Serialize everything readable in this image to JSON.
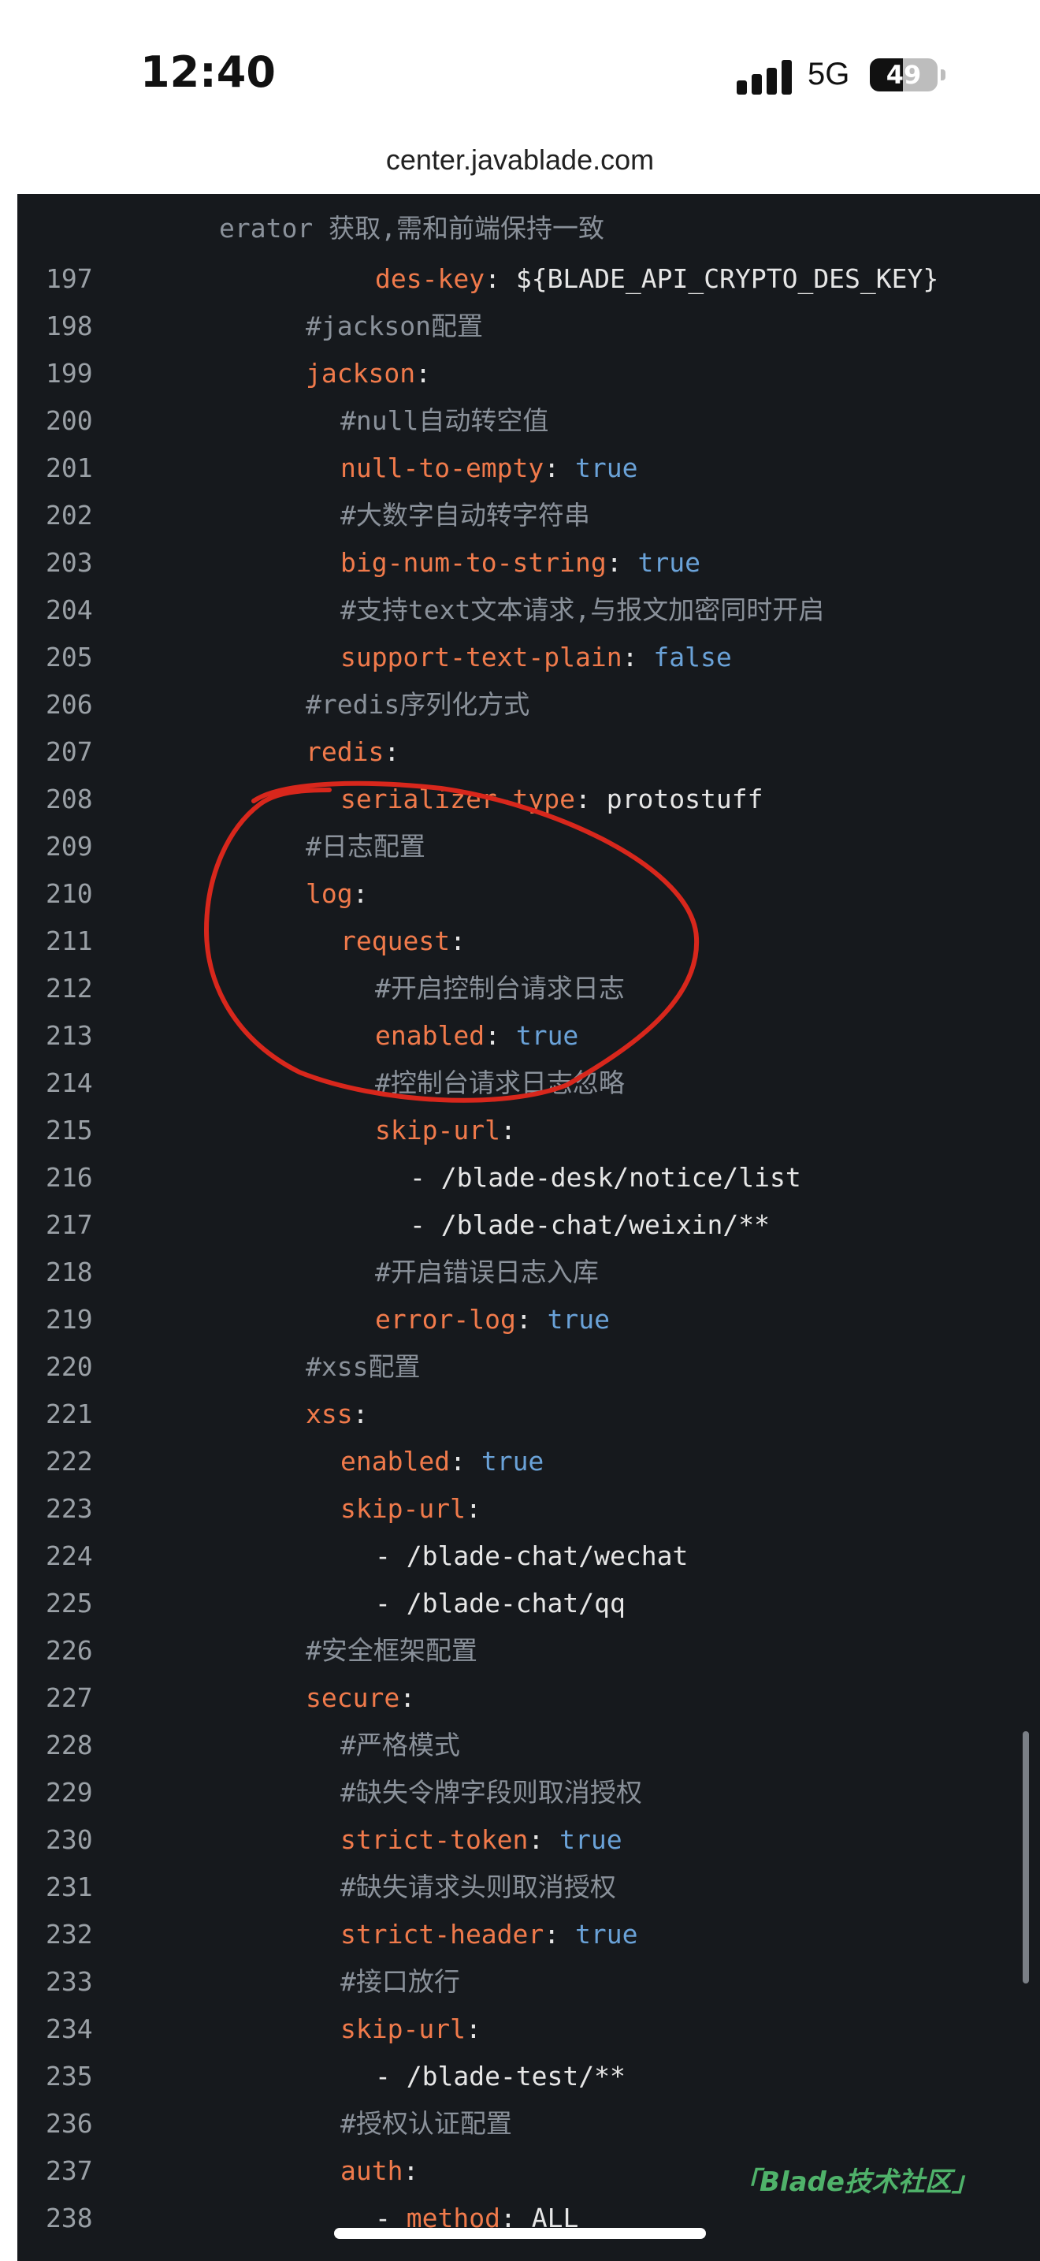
{
  "status_bar": {
    "time": "12:40",
    "network": "5G",
    "battery": "49",
    "battery_level": 0.49
  },
  "url_bar": {
    "url": "center.javablade.com"
  },
  "code": {
    "wrapped_continuation": "erator 获取,需和前端保持一致",
    "lines": [
      {
        "n": "197",
        "indent": 6,
        "parts": [
          {
            "t": "des-key",
            "c": "key"
          },
          {
            "t": ": ",
            "c": "punct"
          },
          {
            "t": "${BLADE_API_CRYPTO_DES_KEY}",
            "c": "plain"
          }
        ]
      },
      {
        "n": "198",
        "indent": 4,
        "parts": [
          {
            "t": "#jackson配置",
            "c": "comment"
          }
        ]
      },
      {
        "n": "199",
        "indent": 4,
        "parts": [
          {
            "t": "jackson",
            "c": "key"
          },
          {
            "t": ":",
            "c": "punct"
          }
        ]
      },
      {
        "n": "200",
        "indent": 5,
        "parts": [
          {
            "t": "#null自动转空值",
            "c": "comment"
          }
        ]
      },
      {
        "n": "201",
        "indent": 5,
        "parts": [
          {
            "t": "null-to-empty",
            "c": "key"
          },
          {
            "t": ": ",
            "c": "punct"
          },
          {
            "t": "true",
            "c": "bool"
          }
        ]
      },
      {
        "n": "202",
        "indent": 5,
        "parts": [
          {
            "t": "#大数字自动转字符串",
            "c": "comment"
          }
        ]
      },
      {
        "n": "203",
        "indent": 5,
        "parts": [
          {
            "t": "big-num-to-string",
            "c": "key"
          },
          {
            "t": ": ",
            "c": "punct"
          },
          {
            "t": "true",
            "c": "bool"
          }
        ]
      },
      {
        "n": "204",
        "indent": 5,
        "parts": [
          {
            "t": "#支持text文本请求,与报文加密同时开启",
            "c": "comment"
          }
        ]
      },
      {
        "n": "205",
        "indent": 5,
        "parts": [
          {
            "t": "support-text-plain",
            "c": "key"
          },
          {
            "t": ": ",
            "c": "punct"
          },
          {
            "t": "false",
            "c": "bool"
          }
        ]
      },
      {
        "n": "206",
        "indent": 4,
        "parts": [
          {
            "t": "#redis序列化方式",
            "c": "comment"
          }
        ]
      },
      {
        "n": "207",
        "indent": 4,
        "parts": [
          {
            "t": "redis",
            "c": "key"
          },
          {
            "t": ":",
            "c": "punct"
          }
        ]
      },
      {
        "n": "208",
        "indent": 5,
        "parts": [
          {
            "t": "serializer-type",
            "c": "key"
          },
          {
            "t": ": ",
            "c": "punct"
          },
          {
            "t": "protostuff",
            "c": "plain"
          }
        ]
      },
      {
        "n": "209",
        "indent": 4,
        "parts": [
          {
            "t": "#日志配置",
            "c": "comment"
          }
        ]
      },
      {
        "n": "210",
        "indent": 4,
        "parts": [
          {
            "t": "log",
            "c": "key"
          },
          {
            "t": ":",
            "c": "punct"
          }
        ]
      },
      {
        "n": "211",
        "indent": 5,
        "parts": [
          {
            "t": "request",
            "c": "key"
          },
          {
            "t": ":",
            "c": "punct"
          }
        ]
      },
      {
        "n": "212",
        "indent": 6,
        "parts": [
          {
            "t": "#开启控制台请求日志",
            "c": "comment"
          }
        ]
      },
      {
        "n": "213",
        "indent": 6,
        "parts": [
          {
            "t": "enabled",
            "c": "key"
          },
          {
            "t": ": ",
            "c": "punct"
          },
          {
            "t": "true",
            "c": "bool"
          }
        ]
      },
      {
        "n": "214",
        "indent": 6,
        "parts": [
          {
            "t": "#控制台请求日志忽略",
            "c": "comment"
          }
        ]
      },
      {
        "n": "215",
        "indent": 6,
        "parts": [
          {
            "t": "skip-url",
            "c": "key"
          },
          {
            "t": ":",
            "c": "punct"
          }
        ]
      },
      {
        "n": "216",
        "indent": 7,
        "parts": [
          {
            "t": "- /blade-desk/notice/list",
            "c": "plain"
          }
        ]
      },
      {
        "n": "217",
        "indent": 7,
        "parts": [
          {
            "t": "- /blade-chat/weixin/**",
            "c": "plain"
          }
        ]
      },
      {
        "n": "218",
        "indent": 6,
        "parts": [
          {
            "t": "#开启错误日志入库",
            "c": "comment"
          }
        ]
      },
      {
        "n": "219",
        "indent": 6,
        "parts": [
          {
            "t": "error-log",
            "c": "key"
          },
          {
            "t": ": ",
            "c": "punct"
          },
          {
            "t": "true",
            "c": "bool"
          }
        ]
      },
      {
        "n": "220",
        "indent": 4,
        "parts": [
          {
            "t": "#xss配置",
            "c": "comment"
          }
        ]
      },
      {
        "n": "221",
        "indent": 4,
        "parts": [
          {
            "t": "xss",
            "c": "key"
          },
          {
            "t": ":",
            "c": "punct"
          }
        ]
      },
      {
        "n": "222",
        "indent": 5,
        "parts": [
          {
            "t": "enabled",
            "c": "key"
          },
          {
            "t": ": ",
            "c": "punct"
          },
          {
            "t": "true",
            "c": "bool"
          }
        ]
      },
      {
        "n": "223",
        "indent": 5,
        "parts": [
          {
            "t": "skip-url",
            "c": "key"
          },
          {
            "t": ":",
            "c": "punct"
          }
        ]
      },
      {
        "n": "224",
        "indent": 6,
        "parts": [
          {
            "t": "- /blade-chat/wechat",
            "c": "plain"
          }
        ]
      },
      {
        "n": "225",
        "indent": 6,
        "parts": [
          {
            "t": "- /blade-chat/qq",
            "c": "plain"
          }
        ]
      },
      {
        "n": "226",
        "indent": 4,
        "parts": [
          {
            "t": "#安全框架配置",
            "c": "comment"
          }
        ]
      },
      {
        "n": "227",
        "indent": 4,
        "parts": [
          {
            "t": "secure",
            "c": "key"
          },
          {
            "t": ":",
            "c": "punct"
          }
        ]
      },
      {
        "n": "228",
        "indent": 5,
        "parts": [
          {
            "t": "#严格模式",
            "c": "comment"
          }
        ]
      },
      {
        "n": "229",
        "indent": 5,
        "parts": [
          {
            "t": "#缺失令牌字段则取消授权",
            "c": "comment"
          }
        ]
      },
      {
        "n": "230",
        "indent": 5,
        "parts": [
          {
            "t": "strict-token",
            "c": "key"
          },
          {
            "t": ": ",
            "c": "punct"
          },
          {
            "t": "true",
            "c": "bool"
          }
        ]
      },
      {
        "n": "231",
        "indent": 5,
        "parts": [
          {
            "t": "#缺失请求头则取消授权",
            "c": "comment"
          }
        ]
      },
      {
        "n": "232",
        "indent": 5,
        "parts": [
          {
            "t": "strict-header",
            "c": "key"
          },
          {
            "t": ": ",
            "c": "punct"
          },
          {
            "t": "true",
            "c": "bool"
          }
        ]
      },
      {
        "n": "233",
        "indent": 5,
        "parts": [
          {
            "t": "#接口放行",
            "c": "comment"
          }
        ]
      },
      {
        "n": "234",
        "indent": 5,
        "parts": [
          {
            "t": "skip-url",
            "c": "key"
          },
          {
            "t": ":",
            "c": "punct"
          }
        ]
      },
      {
        "n": "235",
        "indent": 6,
        "parts": [
          {
            "t": "- /blade-test/**",
            "c": "plain"
          }
        ]
      },
      {
        "n": "236",
        "indent": 5,
        "parts": [
          {
            "t": "#授权认证配置",
            "c": "comment"
          }
        ]
      },
      {
        "n": "237",
        "indent": 5,
        "parts": [
          {
            "t": "auth",
            "c": "key"
          },
          {
            "t": ":",
            "c": "punct"
          }
        ]
      },
      {
        "n": "238",
        "indent": 6,
        "parts": [
          {
            "t": "- ",
            "c": "plain"
          },
          {
            "t": "method",
            "c": "key"
          },
          {
            "t": ": ",
            "c": "punct"
          },
          {
            "t": "ALL",
            "c": "plain"
          }
        ]
      }
    ]
  },
  "watermark": "「Blade技术社区」",
  "colors": {
    "background": "#16191d",
    "key": "#f07a4b",
    "comment": "#8a919a",
    "bool": "#6aa2d8",
    "plain": "#e6e6e6",
    "annotation": "#d8271c",
    "watermark": "#4fb26a"
  }
}
